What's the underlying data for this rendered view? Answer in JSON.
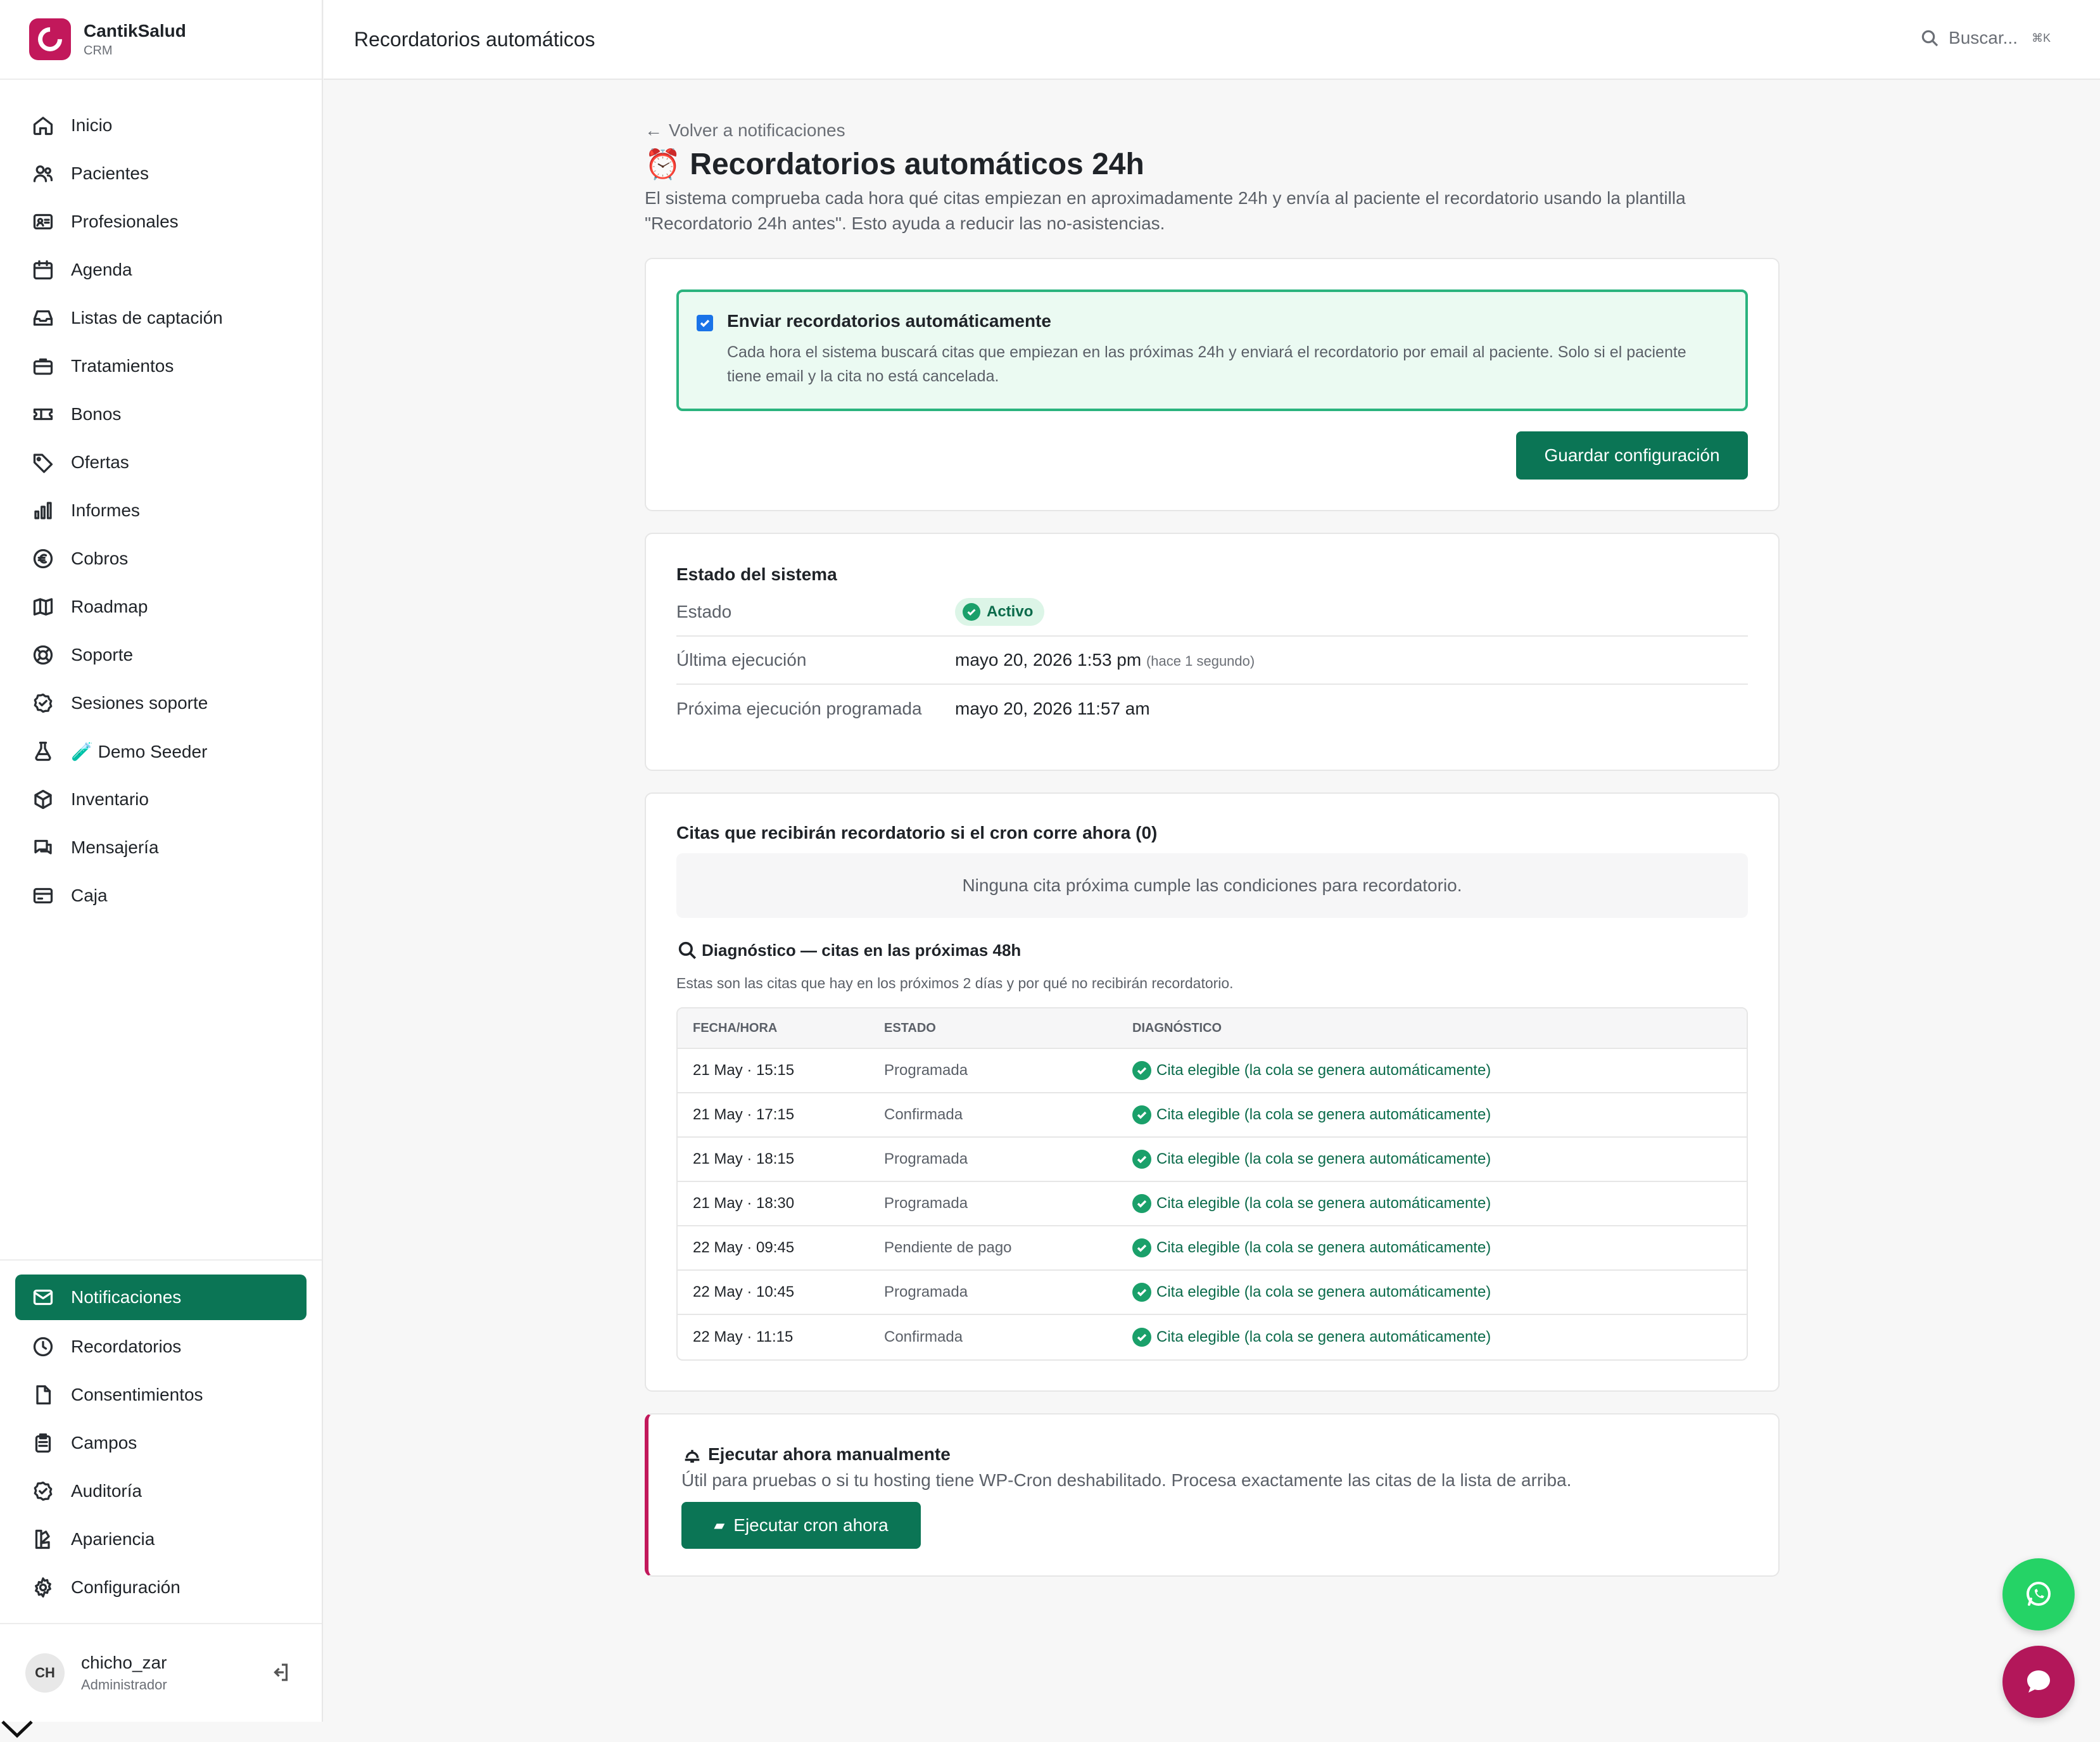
{
  "brand": {
    "name": "CantikSalud",
    "sub": "CRM"
  },
  "topbar": {
    "title": "Recordatorios automáticos",
    "search_placeholder": "Buscar...",
    "search_shortcut": "⌘K"
  },
  "sidebar": {
    "items": [
      {
        "label": "Inicio",
        "icon": "home-icon"
      },
      {
        "label": "Pacientes",
        "icon": "users-icon"
      },
      {
        "label": "Profesionales",
        "icon": "id-card-icon"
      },
      {
        "label": "Agenda",
        "icon": "calendar-icon"
      },
      {
        "label": "Listas de captación",
        "icon": "inbox-icon"
      },
      {
        "label": "Tratamientos",
        "icon": "briefcase-icon"
      },
      {
        "label": "Bonos",
        "icon": "ticket-icon"
      },
      {
        "label": "Ofertas",
        "icon": "tag-icon"
      },
      {
        "label": "Informes",
        "icon": "bar-chart-icon"
      },
      {
        "label": "Cobros",
        "icon": "euro-icon"
      },
      {
        "label": "Roadmap",
        "icon": "map-icon"
      },
      {
        "label": "Soporte",
        "icon": "lifebuoy-icon"
      },
      {
        "label": "Sesiones soporte",
        "icon": "check-badge-icon"
      },
      {
        "label": "🧪 Demo Seeder",
        "icon": "flask-icon"
      },
      {
        "label": "Inventario",
        "icon": "box-icon"
      },
      {
        "label": "Mensajería",
        "icon": "chat-icon"
      },
      {
        "label": "Caja",
        "icon": "credit-card-icon"
      }
    ],
    "bottom_items": [
      {
        "label": "Notificaciones",
        "icon": "mail-icon",
        "active": true
      },
      {
        "label": "Recordatorios",
        "icon": "clock-icon"
      },
      {
        "label": "Consentimientos",
        "icon": "file-icon"
      },
      {
        "label": "Campos",
        "icon": "clipboard-icon"
      },
      {
        "label": "Auditoría",
        "icon": "check-badge-icon"
      },
      {
        "label": "Apariencia",
        "icon": "palette-icon"
      },
      {
        "label": "Configuración",
        "icon": "gear-icon"
      }
    ]
  },
  "user": {
    "initials": "CH",
    "name": "chicho_zar",
    "role": "Administrador"
  },
  "page": {
    "back_label": "Volver a notificaciones",
    "title_emoji": "⏰",
    "title": "Recordatorios automáticos 24h",
    "description": "El sistema comprueba cada hora qué citas empiezan en aproximadamente 24h y envía al paciente el recordatorio usando la plantilla \"Recordatorio 24h antes\". Esto ayuda a reducir las no-asistencias."
  },
  "config": {
    "checkbox_label": "Enviar recordatorios automáticamente",
    "checkbox_checked": true,
    "checkbox_help": "Cada hora el sistema buscará citas que empiezan en las próximas 24h y enviará el recordatorio por email al paciente. Solo si el paciente tiene email y la cita no está cancelada.",
    "save_label": "Guardar configuración"
  },
  "status": {
    "title": "Estado del sistema",
    "state_key": "Estado",
    "state_value": "Activo",
    "last_run_key": "Última ejecución",
    "last_run_value": "mayo 20, 2026 1:53 pm",
    "last_run_ago": "(hace 1 segundo)",
    "next_run_key": "Próxima ejecución programada",
    "next_run_value": "mayo 20, 2026 11:57 am"
  },
  "queue": {
    "title": "Citas que recibirán recordatorio si el cron corre ahora (0)",
    "empty": "Ninguna cita próxima cumple las condiciones para recordatorio."
  },
  "diagnostic": {
    "title": "Diagnóstico — citas en las próximas 48h",
    "subtitle": "Estas son las citas que hay en los próximos 2 días y por qué no recibirán recordatorio.",
    "columns": [
      "FECHA/HORA",
      "ESTADO",
      "DIAGNÓSTICO"
    ],
    "rows": [
      {
        "datetime": "21 May · 15:15",
        "status": "Programada",
        "diagnosis": "Cita elegible (la cola se genera automáticamente)"
      },
      {
        "datetime": "21 May · 17:15",
        "status": "Confirmada",
        "diagnosis": "Cita elegible (la cola se genera automáticamente)"
      },
      {
        "datetime": "21 May · 18:15",
        "status": "Programada",
        "diagnosis": "Cita elegible (la cola se genera automáticamente)"
      },
      {
        "datetime": "21 May · 18:30",
        "status": "Programada",
        "diagnosis": "Cita elegible (la cola se genera automáticamente)"
      },
      {
        "datetime": "22 May · 09:45",
        "status": "Pendiente de pago",
        "diagnosis": "Cita elegible (la cola se genera automáticamente)"
      },
      {
        "datetime": "22 May · 10:45",
        "status": "Programada",
        "diagnosis": "Cita elegible (la cola se genera automáticamente)"
      },
      {
        "datetime": "22 May · 11:15",
        "status": "Confirmada",
        "diagnosis": "Cita elegible (la cola se genera automáticamente)"
      }
    ]
  },
  "manual": {
    "title": "Ejecutar ahora manualmente",
    "description": "Útil para pruebas o si tu hosting tiene WP-Cron deshabilitado. Procesa exactamente las citas de la lista de arriba.",
    "button_label": "Ejecutar cron ahora"
  },
  "colors": {
    "primary": "#0b7555",
    "brand": "#c2185b",
    "success": "#1aa06a",
    "whatsapp": "#25d366"
  }
}
